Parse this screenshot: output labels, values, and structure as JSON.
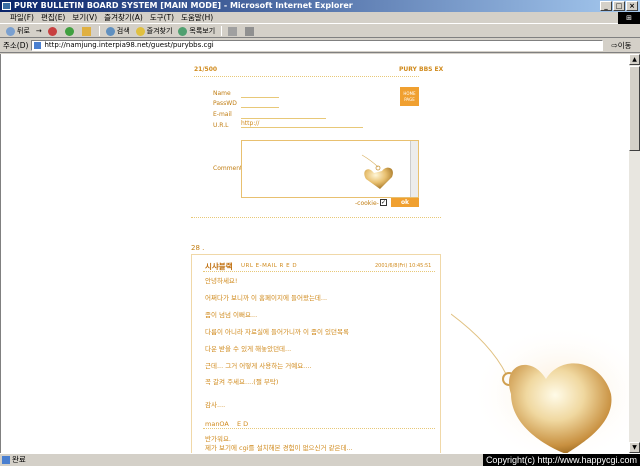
{
  "window": {
    "title": "PURY BULLETIN BOARD SYSTEM [MAIN MODE] - Microsoft Internet Explorer",
    "buttons": [
      "_",
      "□",
      "×"
    ]
  },
  "menu": [
    "파일(F)",
    "편집(E)",
    "보기(V)",
    "즐겨찾기(A)",
    "도구(T)",
    "도움말(H)"
  ],
  "toolbar": {
    "back": "뒤로",
    "forward": "→",
    "search": "검색",
    "favorites": "즐겨찾기",
    "history": "목록보기"
  },
  "address": {
    "label": "주소(D)",
    "url": "http://namjung.interpia98.net/guest/purybbs.cgi",
    "go": "⇨이동"
  },
  "board": {
    "page_info": "21/500",
    "board_name": "PURY BBS EX",
    "home_button": "HOME PAGE",
    "form": {
      "name_label": "Name",
      "password_label": "PassWD",
      "email_label": "E-mail",
      "url_label": "U.R.L",
      "url_value": "http://",
      "comment_label": "Comment",
      "cookie_label": "-cookie-",
      "cookie_checked": "✓",
      "ok_label": "ok"
    },
    "post": {
      "number": "28 .",
      "author": "시샤블랙",
      "links": "URL E-MAIL  R  E  D",
      "date": "2001/6/8(Fri) 10:45:51",
      "lines": [
        "안녕하세요!",
        "어쩌다가 보니까 이 홈페이지에 들어왔는데...",
        "좀이 넘넘 이뻐요...",
        "다름이 아니라 자료실에 들어가니까 이 좀이 있던목록",
        "다운 받을 수 있게 해놓았던데...",
        "근데... 그거 어떻게 사용하는 거예요....",
        "꼭 갈켜 주세요....(쩔 부탁)",
        "",
        "감사...."
      ],
      "reply_author": "manOA",
      "reply_links": "E  D",
      "reply_lines": [
        "반가워요.",
        "제가 보기에 cgi를 설치해본 경험이 없으신거 같은데..."
      ]
    }
  },
  "status": {
    "text": "완료",
    "copyright": "Copyright(c) http://www.happycgi.com"
  },
  "colors": {
    "accent": "#d08a1c",
    "button": "#f0a030",
    "chrome": "#d4d0c8",
    "titlebar": "#0a246a"
  }
}
